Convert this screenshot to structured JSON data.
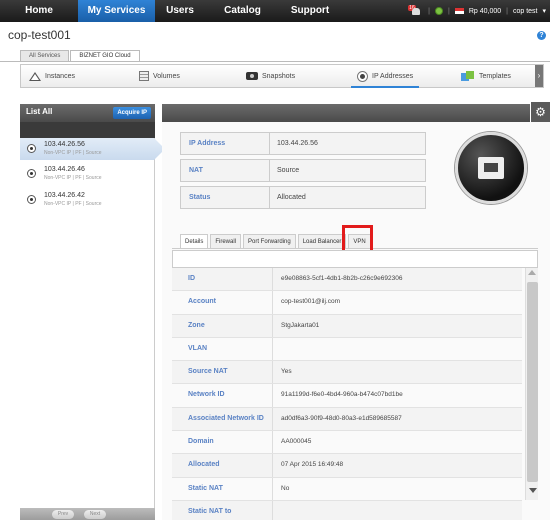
{
  "nav": {
    "items": [
      {
        "label": "Home",
        "active": false
      },
      {
        "label": "My Services",
        "active": true
      },
      {
        "label": "Users",
        "active": false
      },
      {
        "label": "Catalog",
        "active": false
      },
      {
        "label": "Support",
        "active": false
      }
    ],
    "notification_count": "16",
    "balance": "Rp 40,000",
    "user": "cop test",
    "user_caret": "▾"
  },
  "header": {
    "project_title": "cop-test001",
    "help_icon": "?",
    "zone_tabs": [
      {
        "label": "All Services",
        "active": false
      },
      {
        "label": "BIZNET GIO Cloud",
        "active": true
      }
    ]
  },
  "section_nav": {
    "items": [
      {
        "label": "Instances",
        "icon": "instances-icon",
        "active": false
      },
      {
        "label": "Volumes",
        "icon": "volumes-icon",
        "active": false
      },
      {
        "label": "Snapshots",
        "icon": "snapshots-icon",
        "active": false
      },
      {
        "label": "IP Addresses",
        "icon": "ip-address-icon",
        "active": true
      },
      {
        "label": "Templates",
        "icon": "templates-icon",
        "active": false
      }
    ],
    "more": "›"
  },
  "list": {
    "title": "List All",
    "acquire_label": "Acquire IP",
    "items": [
      {
        "ip": "103.44.26.56",
        "meta": "Non-VPC IP | PF | Source",
        "selected": true
      },
      {
        "ip": "103.44.26.46",
        "meta": "Non-VPC IP | PF | Source",
        "selected": false
      },
      {
        "ip": "103.44.26.42",
        "meta": "Non-VPC IP | PF | Source",
        "selected": false
      }
    ],
    "prev_label": "Prev",
    "next_label": "Next"
  },
  "summary": {
    "rows": [
      {
        "label": "IP Address",
        "value": "103.44.26.56"
      },
      {
        "label": "NAT",
        "value": "Source"
      },
      {
        "label": "Status",
        "value": "Allocated"
      }
    ]
  },
  "detail_tabs": [
    {
      "label": "Details",
      "active": true
    },
    {
      "label": "Firewall",
      "active": false
    },
    {
      "label": "Port Forwarding",
      "active": false
    },
    {
      "label": "Load Balancer",
      "active": false
    },
    {
      "label": "VPN",
      "active": false
    }
  ],
  "details": [
    {
      "label": "ID",
      "value": "e9e08863-5cf1-4db1-8b2b-c26c9e692306"
    },
    {
      "label": "Account",
      "value": "cop-test001@ilj.com"
    },
    {
      "label": "Zone",
      "value": "StgJakarta01"
    },
    {
      "label": "VLAN",
      "value": ""
    },
    {
      "label": "Source NAT",
      "value": "Yes"
    },
    {
      "label": "Network ID",
      "value": "91a1199d-f6e0-4bd4-960a-b474c07bd1be"
    },
    {
      "label": "Associated Network ID",
      "value": "ad0df6a3-90f9-48d0-80a3-e1d589685587"
    },
    {
      "label": "Domain",
      "value": "AA000045"
    },
    {
      "label": "Allocated",
      "value": "07 Apr 2015 16:49:48"
    },
    {
      "label": "Static NAT",
      "value": "No"
    },
    {
      "label": "Static NAT to",
      "value": ""
    }
  ],
  "colors": {
    "nav_active": "#2f83d6",
    "label_blue": "#5a82c4",
    "highlight_red": "#e21b1b"
  }
}
